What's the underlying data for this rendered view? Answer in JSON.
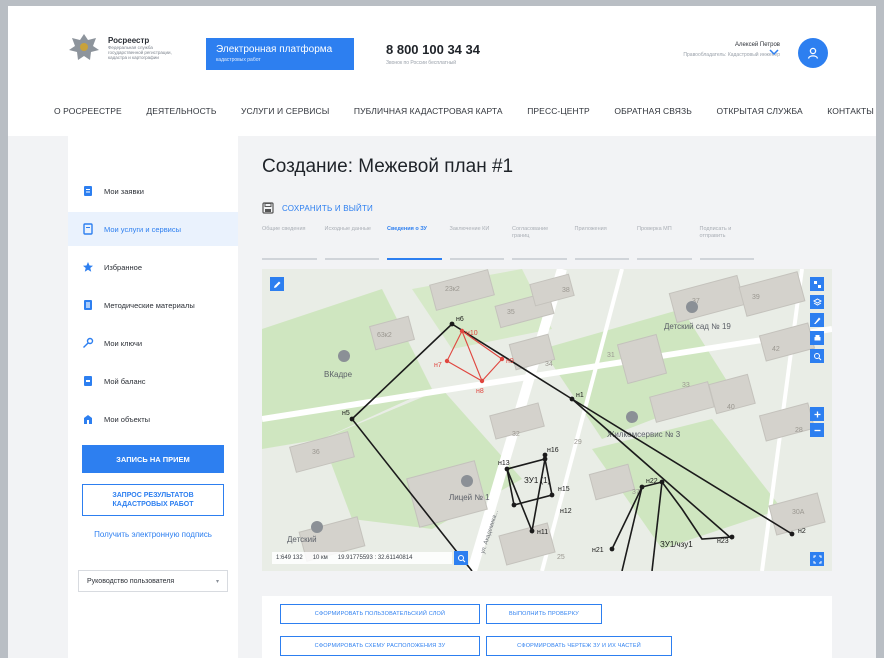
{
  "header": {
    "logo_name": "Росреестр",
    "logo_sub": "Федеральная служба государственной регистрации, кадастра и картографии",
    "platform_title": "Электронная платформа",
    "platform_sub": "кадастровых работ",
    "phone": "8 800 100 34 34",
    "phone_caption": "Звонок по России бесплатный",
    "user_name": "Алексей Петров",
    "user_role": "Правообладатель: Кадастровый инженер"
  },
  "nav": [
    "О РОСРЕЕСТРЕ",
    "ДЕЯТЕЛЬНОСТЬ",
    "УСЛУГИ И СЕРВИСЫ",
    "ПУБЛИЧНАЯ КАДАСТРОВАЯ КАРТА",
    "ПРЕСС-ЦЕНТР",
    "ОБРАТНАЯ СВЯЗЬ",
    "ОТКРЫТАЯ СЛУЖБА",
    "КОНТАКТЫ"
  ],
  "sidebar": {
    "items": [
      {
        "label": "Мои заявки",
        "icon": "document-icon"
      },
      {
        "label": "Мои услуги и сервисы",
        "icon": "services-icon"
      },
      {
        "label": "Избранное",
        "icon": "star-icon"
      },
      {
        "label": "Методические материалы",
        "icon": "book-icon"
      },
      {
        "label": "Мои ключи",
        "icon": "key-icon"
      },
      {
        "label": "Мой баланс",
        "icon": "wallet-icon"
      },
      {
        "label": "Мои объекты",
        "icon": "building-icon"
      }
    ],
    "active_index": 1,
    "appointment_button": "ЗАПИСЬ НА ПРИЕМ",
    "results_button": "ЗАПРОС РЕЗУЛЬТАТОВ КАДАСТРОВЫХ РАБОТ",
    "signature_link": "Получить электронную подпись",
    "guide_select": "Руководство пользователя"
  },
  "main": {
    "title": "Создание: Межевой план #1",
    "save_exit": "СОХРАНИТЬ И ВЫЙТИ",
    "steps": [
      "Общие сведения",
      "Исходные данные",
      "Сведения о ЗУ",
      "Заключение КИ",
      "Согласование границ",
      "Приложения",
      "Проверка МП",
      "Подписать и отправить"
    ],
    "active_step": 2
  },
  "map": {
    "scale_readout": "1:649 132",
    "distance": "10 км",
    "coords": "19.91775593 : 32.61140814",
    "parcel_labels": [
      "н1",
      "н2",
      "н5",
      "н6",
      "н7",
      "н8",
      "н9",
      "н10",
      "н11",
      "н12",
      "н13",
      "н15",
      "н16",
      "н21",
      "н22",
      "н23"
    ],
    "object_labels": [
      "ЗУ1 (1)",
      "ЗУ1/чзу1",
      "Детский сад № 19",
      "ВКадре",
      "Лицей № 1",
      "Жилкомсервис № 3",
      "Детский"
    ],
    "building_numbers": [
      "23к2",
      "35",
      "63к2",
      "38",
      "34",
      "33",
      "31",
      "32",
      "29",
      "40",
      "37",
      "39",
      "42",
      "36",
      "37",
      "30А",
      "25",
      "28"
    ],
    "street": "ул. Академика...",
    "colors": {
      "contour": "#1b1b1b",
      "red_contour": "#e0463f",
      "accent": "#2d7ff0"
    }
  },
  "actions": {
    "btn_layer": "СФОРМИРОВАТЬ ПОЛЬЗОВАТЕЛЬСКИЙ СЛОЙ",
    "btn_check": "ВЫПОЛНИТЬ ПРОВЕРКУ",
    "btn_scheme": "СФОРМИРОВАТЬ СХЕМУ РАСПОЛОЖЕНИЯ ЗУ",
    "btn_drawing": "СФОРМИРОВАТЬ ЧЕРТЕЖ ЗУ И ИХ ЧАСТЕЙ"
  }
}
